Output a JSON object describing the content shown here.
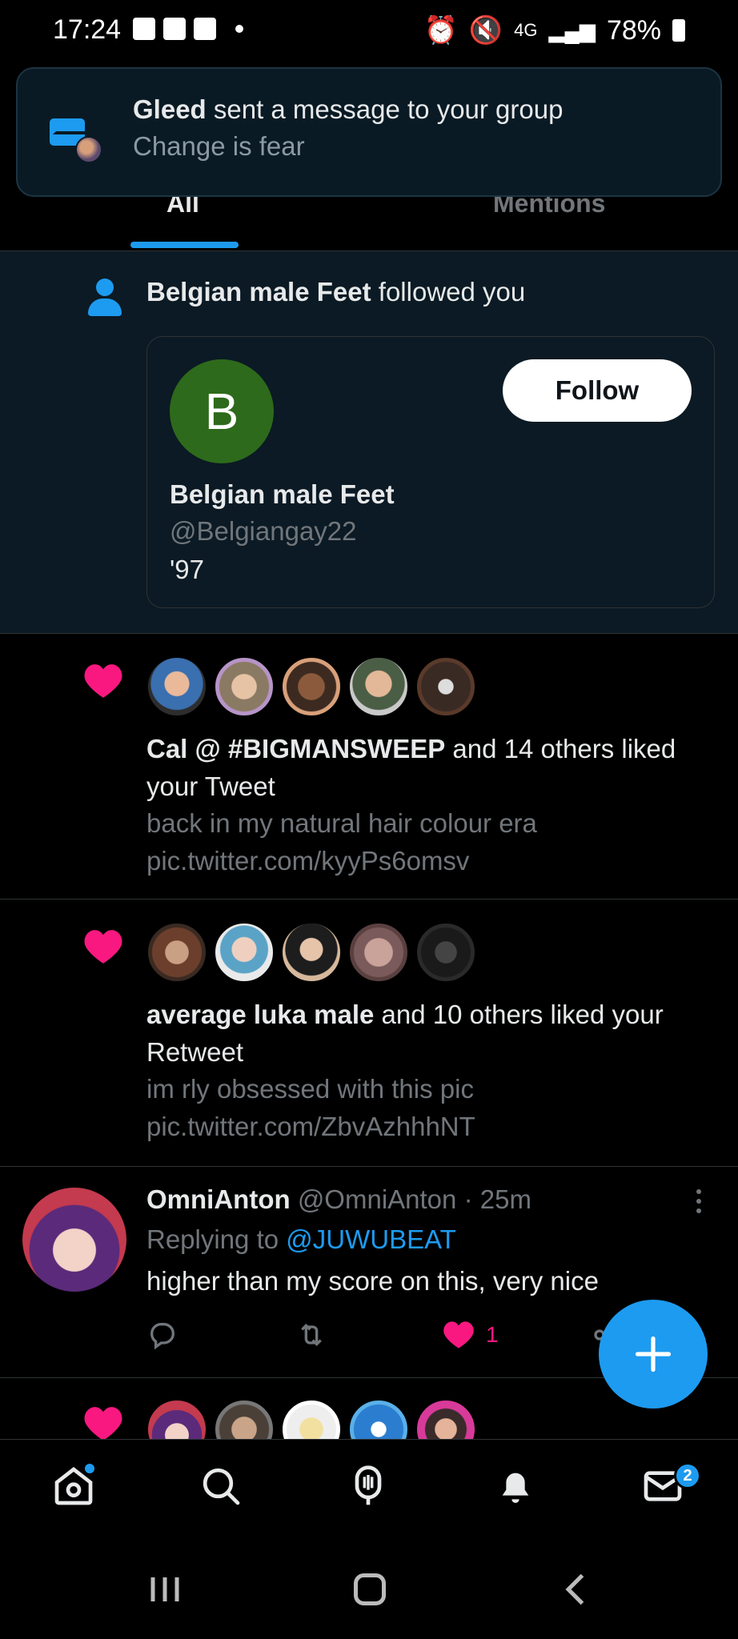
{
  "status_bar": {
    "time": "17:24",
    "network": "4G",
    "battery": "78%"
  },
  "banner": {
    "sender": "Gleed",
    "message": " sent a message to your group",
    "preview": "Change is fear"
  },
  "tabs": [
    {
      "label": "All",
      "active": true
    },
    {
      "label": "Mentions",
      "active": false
    }
  ],
  "follow_notification": {
    "name": "Belgian male Feet",
    "action": " followed you",
    "card": {
      "avatar_letter": "B",
      "name": "Belgian male Feet",
      "handle": "@Belgiangay22",
      "bio": "'97",
      "follow_label": "Follow"
    }
  },
  "likes": [
    {
      "actor": "Cal @ #BIGMANSWEEP",
      "action": " and 14 others liked your Tweet",
      "tweet_text": "back in my natural hair colour era",
      "tweet_link": "pic.twitter.com/kyyPs6omsv"
    },
    {
      "actor": "average luka male",
      "action": " and 10 others liked your Retweet",
      "tweet_text": "im rly obsessed with this pic",
      "tweet_link": "pic.twitter.com/ZbvAzhhhNT"
    }
  ],
  "tweet": {
    "name": "OmniAnton",
    "handle": "@OmniAnton",
    "separator": " · ",
    "time": "25m",
    "replying_prefix": "Replying to ",
    "replying_to": "@JUWUBEAT",
    "text": "higher than my score on this, very nice",
    "like_count": "1"
  },
  "bottom_nav": {
    "messages_badge": "2"
  },
  "colors": {
    "accent": "#1d9bf0",
    "like": "#f91880",
    "follow_avatar": "#2e6a1b"
  }
}
